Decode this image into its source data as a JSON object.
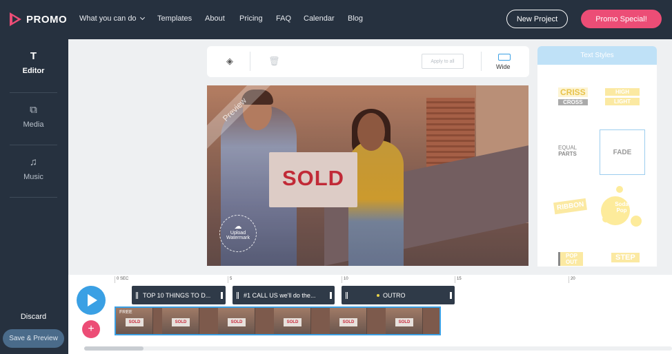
{
  "brand": {
    "name": "PROMO",
    "accent": "#ec4d76",
    "nav_bg": "#26313f",
    "highlight": "#3aa0e4"
  },
  "nav": {
    "items": [
      "What you can do",
      "Templates",
      "About",
      "Pricing",
      "FAQ",
      "Calendar",
      "Blog"
    ],
    "new_project": "New Project",
    "promo_special": "Promo Special!"
  },
  "sidebar": {
    "items": [
      {
        "label": "Editor",
        "icon": "text-t-icon"
      },
      {
        "label": "Media",
        "icon": "media-stack-icon"
      },
      {
        "label": "Music",
        "icon": "music-note-icon"
      }
    ],
    "discard": "Discard",
    "save_preview": "Save & Preview"
  },
  "toolbar": {
    "apply_all": "Apply to all",
    "wide_label": "Wide"
  },
  "preview": {
    "watermark": "Preview",
    "sign_text": "SOLD",
    "upload_label": "Upload Watermark"
  },
  "text_styles": {
    "header": "Text Styles",
    "styles": {
      "criss_top": "CRISS",
      "criss_bottom": "CROSS",
      "high": "HIGH",
      "light": "LIGHT",
      "equal_top": "EQUAL",
      "equal_bottom": "PARTS",
      "fade": "FADE",
      "ribbon": "RIBBON",
      "soda": "Soda Pop",
      "pop_out": "POP OUT",
      "step": "STEP"
    }
  },
  "timeline": {
    "ticks": [
      "0 SEC",
      "5",
      "10",
      "15",
      "20"
    ],
    "segments": [
      "TOP 10 THINGS TO D...",
      "#1 CALL US we'll do the...",
      "OUTRO"
    ],
    "clip_badge": "FREE",
    "clip_sign": "SOLD"
  }
}
